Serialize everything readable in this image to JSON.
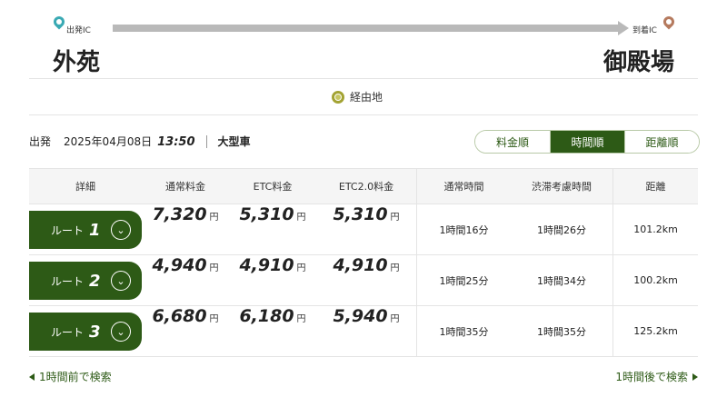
{
  "route": {
    "start_ic_label": "出発IC",
    "end_ic_label": "到着IC",
    "start": "外苑",
    "end": "御殿場"
  },
  "waypoint": {
    "label": "経由地"
  },
  "conditions": {
    "departure_label": "出発",
    "date": "2025年04月08日",
    "time": "13:50",
    "vehicle": "大型車"
  },
  "sort": {
    "options": [
      "料金順",
      "時間順",
      "距離順"
    ],
    "active": "時間順"
  },
  "table": {
    "headers": [
      "詳細",
      "通常料金",
      "ETC料金",
      "ETC2.0料金",
      "通常時間",
      "渋滞考慮時間",
      "距離"
    ],
    "currency": "円",
    "route_prefix": "ルート",
    "rows": [
      {
        "num": "1",
        "normal": "7,320",
        "etc": "5,310",
        "etc2": "5,310",
        "normal_time": "1時間16分",
        "congestion_time": "1時間26分",
        "distance": "101.2km"
      },
      {
        "num": "2",
        "normal": "4,940",
        "etc": "4,910",
        "etc2": "4,910",
        "normal_time": "1時間25分",
        "congestion_time": "1時間34分",
        "distance": "100.2km"
      },
      {
        "num": "3",
        "normal": "6,680",
        "etc": "6,180",
        "etc2": "5,940",
        "normal_time": "1時間35分",
        "congestion_time": "1時間35分",
        "distance": "125.2km"
      }
    ]
  },
  "nav": {
    "prev": "1時間前で検索",
    "next": "1時間後で検索"
  },
  "colors": {
    "accent": "#2d5a16",
    "start_pin": "#39a9b3",
    "end_pin": "#b57a5e",
    "waypoint": "#a3a333"
  }
}
